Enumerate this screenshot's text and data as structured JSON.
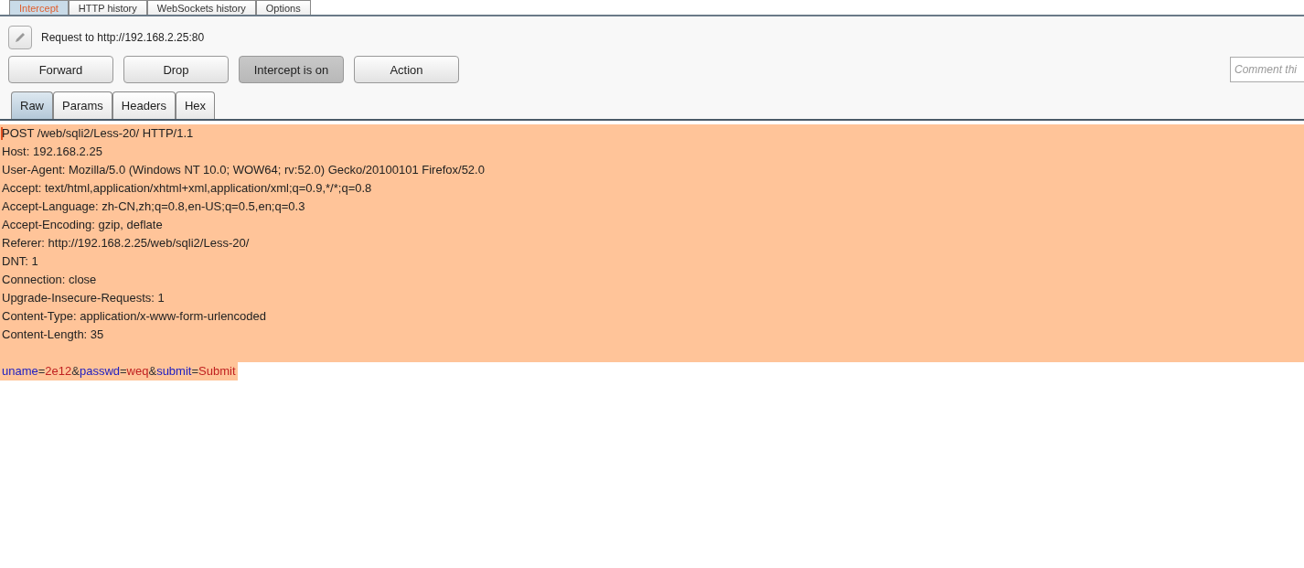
{
  "tabs": [
    {
      "label": "Intercept",
      "selected": true
    },
    {
      "label": "HTTP history",
      "selected": false
    },
    {
      "label": "WebSockets history",
      "selected": false
    },
    {
      "label": "Options",
      "selected": false
    }
  ],
  "request_label": "Request to http://192.168.2.25:80",
  "buttons": [
    {
      "label": "Forward",
      "pressed": false
    },
    {
      "label": "Drop",
      "pressed": false
    },
    {
      "label": "Intercept is on",
      "pressed": true
    },
    {
      "label": "Action",
      "pressed": false
    }
  ],
  "comment": {
    "placeholder": "Comment thi"
  },
  "view_tabs": [
    {
      "label": "Raw",
      "selected": true
    },
    {
      "label": "Params",
      "selected": false
    },
    {
      "label": "Headers",
      "selected": false
    },
    {
      "label": "Hex",
      "selected": false
    }
  ],
  "request_lines": [
    "POST /web/sqli2/Less-20/ HTTP/1.1",
    "Host: 192.168.2.25",
    "User-Agent: Mozilla/5.0 (Windows NT 10.0; WOW64; rv:52.0) Gecko/20100101 Firefox/52.0",
    "Accept: text/html,application/xhtml+xml,application/xml;q=0.9,*/*;q=0.8",
    "Accept-Language: zh-CN,zh;q=0.8,en-US;q=0.5,en;q=0.3",
    "Accept-Encoding: gzip, deflate",
    "Referer: http://192.168.2.25/web/sqli2/Less-20/",
    "DNT: 1",
    "Connection: close",
    "Upgrade-Insecure-Requests: 1",
    "Content-Type: application/x-www-form-urlencoded",
    "Content-Length: 35"
  ],
  "body_tokens": [
    {
      "kind": "name",
      "text": "uname"
    },
    {
      "kind": "operator",
      "text": "="
    },
    {
      "kind": "value",
      "text": "2e12"
    },
    {
      "kind": "operator",
      "text": "&"
    },
    {
      "kind": "name",
      "text": "passwd"
    },
    {
      "kind": "operator",
      "text": "="
    },
    {
      "kind": "value",
      "text": "weq"
    },
    {
      "kind": "operator",
      "text": "&"
    },
    {
      "kind": "name",
      "text": "submit"
    },
    {
      "kind": "operator",
      "text": "="
    },
    {
      "kind": "value",
      "text": "Submit"
    }
  ]
}
